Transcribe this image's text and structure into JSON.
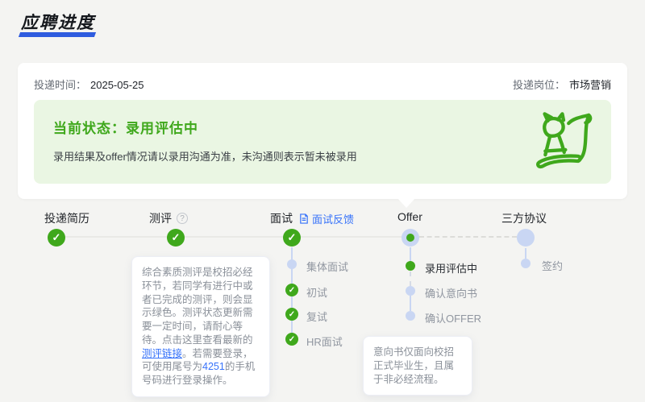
{
  "theme": {
    "bg": "#f4f4f2",
    "accent-blue": "#2f5cdf",
    "link-blue": "#3672fa",
    "green": "#3fa81c",
    "green-bg": "#eaf6e3",
    "light-blue": "#c9d6f3",
    "text-dark": "#1f2329",
    "text-gray": "#646a73",
    "text-light": "#9096a0"
  },
  "header": {
    "title": "应聘进度"
  },
  "card": {
    "apply_time_label": "投递时间：",
    "apply_time_value": "2025-05-25",
    "position_label": "投递岗位：",
    "position_value": "市场营销",
    "status_title": "当前状态：录用评估中",
    "status_desc": "录用结果及offer情况请以录用沟通为准，未沟通则表示暂未被录用"
  },
  "icons": {
    "check": "✓",
    "help": "?"
  },
  "timeline": {
    "stages": [
      {
        "label": "投递简历",
        "state": "done"
      },
      {
        "label": "测评",
        "state": "done"
      },
      {
        "label": "面试",
        "state": "done",
        "feedback_link": "面试反馈"
      },
      {
        "label": "Offer",
        "state": "current"
      },
      {
        "label": "三方协议",
        "state": "pending"
      }
    ],
    "interview_steps": [
      {
        "label": "集体面试",
        "state": "pending"
      },
      {
        "label": "初试",
        "state": "done"
      },
      {
        "label": "复试",
        "state": "done"
      },
      {
        "label": "HR面试",
        "state": "done"
      }
    ],
    "offer_steps": [
      {
        "label": "录用评估中",
        "state": "current"
      },
      {
        "label": "确认意向书",
        "state": "pending"
      },
      {
        "label": "确认OFFER",
        "state": "pending"
      }
    ],
    "agreement_steps": [
      {
        "label": "签约",
        "state": "pending"
      }
    ]
  },
  "tooltips": {
    "assessment": {
      "part1": "综合素质测评是校招必经环节，若同学有进行中或者已完成的测评，则会显示绿色。测评状态更新需要一定时间，请耐心等待。点击这里查看最新的",
      "link": "测评链接",
      "part2": "。若需要登录，可使用尾号为",
      "phone": "4251",
      "part3": "的手机号码进行登录操作。"
    },
    "offer_note": "意向书仅面向校招正式毕业生，且属于非必经流程。"
  }
}
